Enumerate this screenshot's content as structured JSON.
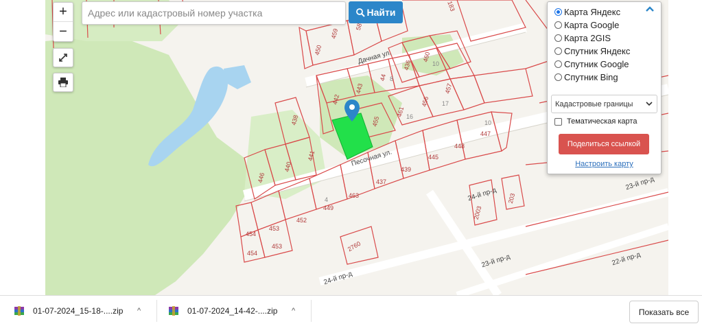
{
  "search": {
    "placeholder": "Адрес или кадастровый номер участка",
    "button_label": "Найти"
  },
  "zoom": {
    "in_label": "+",
    "out_label": "−"
  },
  "layers": {
    "options": [
      "Карта Яндекс",
      "Карта Google",
      "Карта 2GIS",
      "Спутник Яндекс",
      "Спутник Google",
      "Спутник Bing"
    ],
    "selected": "Карта Яндекс",
    "overlay_select": "Кадастровые границы",
    "thematic_label": "Тематическая карта",
    "share_label": "Поделиться ссылкой",
    "configure_label": "Настроить карту"
  },
  "map": {
    "streets": [
      "Дачная ул.",
      "Песочная ул.",
      "24-й пр-д",
      "24-й пр-д",
      "23-й пр-д",
      "23-й пр-д",
      "22-й пр-д"
    ],
    "parcels": [
      "183",
      "459",
      "58",
      "450",
      "460",
      "436",
      "10",
      "44",
      "8",
      "443",
      "442",
      "457",
      "456",
      "461",
      "16",
      "17",
      "455",
      "10",
      "447",
      "448",
      "438",
      "441",
      "440",
      "446",
      "445",
      "439",
      "437",
      "463",
      "4",
      "449",
      "452",
      "453",
      "454",
      "453",
      "454",
      "2760",
      "2003",
      "203"
    ]
  },
  "downloads": {
    "items": [
      "01-07-2024_15-18-....zip",
      "01-07-2024_14-42-....zip"
    ],
    "show_all_label": "Показать все"
  },
  "colors": {
    "accent_blue": "#2c86c9",
    "share_red": "#d9534f",
    "parcel_red": "#d94a4a",
    "selected_parcel": "#22e04a",
    "water": "#a8d4f0",
    "greenery": "#cfe8b8"
  }
}
